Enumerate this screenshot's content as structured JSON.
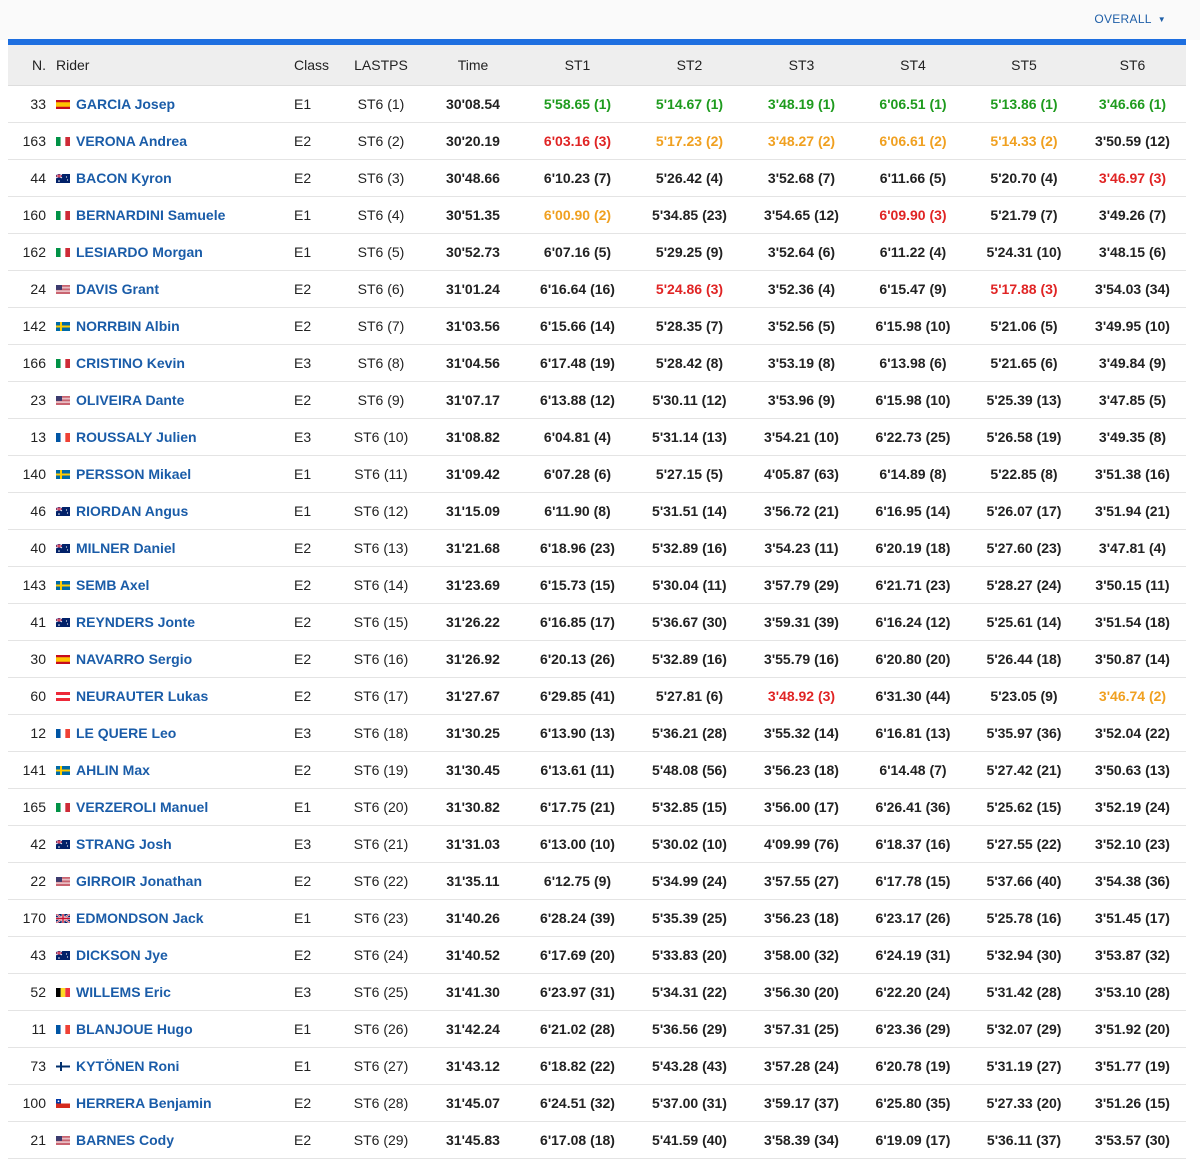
{
  "header": {
    "overall_label": "OVERALL"
  },
  "columns": [
    "N.",
    "Rider",
    "Class",
    "LASTPS",
    "Time",
    "ST1",
    "ST2",
    "ST3",
    "ST4",
    "ST5",
    "ST6"
  ],
  "rows": [
    {
      "n": "33",
      "flag": "es",
      "rider": "GARCIA Josep",
      "cls": "E1",
      "last": "ST6 (1)",
      "time": "30'08.54",
      "st": [
        "5'58.65 (1)",
        "5'14.67 (1)",
        "3'48.19 (1)",
        "6'06.51 (1)",
        "5'13.86 (1)",
        "3'46.66 (1)"
      ],
      "hl": [
        "green",
        "green",
        "green",
        "green",
        "green",
        "green"
      ]
    },
    {
      "n": "163",
      "flag": "it",
      "rider": "VERONA Andrea",
      "cls": "E2",
      "last": "ST6 (2)",
      "time": "30'20.19",
      "st": [
        "6'03.16 (3)",
        "5'17.23 (2)",
        "3'48.27 (2)",
        "6'06.61 (2)",
        "5'14.33 (2)",
        "3'50.59 (12)"
      ],
      "hl": [
        "red",
        "orange",
        "orange",
        "orange",
        "orange",
        ""
      ]
    },
    {
      "n": "44",
      "flag": "au",
      "rider": "BACON Kyron",
      "cls": "E2",
      "last": "ST6 (3)",
      "time": "30'48.66",
      "st": [
        "6'10.23 (7)",
        "5'26.42 (4)",
        "3'52.68 (7)",
        "6'11.66 (5)",
        "5'20.70 (4)",
        "3'46.97 (3)"
      ],
      "hl": [
        "",
        "",
        "",
        "",
        "",
        "red"
      ]
    },
    {
      "n": "160",
      "flag": "it",
      "rider": "BERNARDINI Samuele",
      "cls": "E1",
      "last": "ST6 (4)",
      "time": "30'51.35",
      "st": [
        "6'00.90 (2)",
        "5'34.85 (23)",
        "3'54.65 (12)",
        "6'09.90 (3)",
        "5'21.79 (7)",
        "3'49.26 (7)"
      ],
      "hl": [
        "orange",
        "",
        "",
        "red",
        "",
        ""
      ]
    },
    {
      "n": "162",
      "flag": "it",
      "rider": "LESIARDO Morgan",
      "cls": "E1",
      "last": "ST6 (5)",
      "time": "30'52.73",
      "st": [
        "6'07.16 (5)",
        "5'29.25 (9)",
        "3'52.64 (6)",
        "6'11.22 (4)",
        "5'24.31 (10)",
        "3'48.15 (6)"
      ],
      "hl": [
        "",
        "",
        "",
        "",
        "",
        ""
      ]
    },
    {
      "n": "24",
      "flag": "us",
      "rider": "DAVIS Grant",
      "cls": "E2",
      "last": "ST6 (6)",
      "time": "31'01.24",
      "st": [
        "6'16.64 (16)",
        "5'24.86 (3)",
        "3'52.36 (4)",
        "6'15.47 (9)",
        "5'17.88 (3)",
        "3'54.03 (34)"
      ],
      "hl": [
        "",
        "red",
        "",
        "",
        "red",
        ""
      ]
    },
    {
      "n": "142",
      "flag": "se",
      "rider": "NORRBIN Albin",
      "cls": "E2",
      "last": "ST6 (7)",
      "time": "31'03.56",
      "st": [
        "6'15.66 (14)",
        "5'28.35 (7)",
        "3'52.56 (5)",
        "6'15.98 (10)",
        "5'21.06 (5)",
        "3'49.95 (10)"
      ],
      "hl": [
        "",
        "",
        "",
        "",
        "",
        ""
      ]
    },
    {
      "n": "166",
      "flag": "it",
      "rider": "CRISTINO Kevin",
      "cls": "E3",
      "last": "ST6 (8)",
      "time": "31'04.56",
      "st": [
        "6'17.48 (19)",
        "5'28.42 (8)",
        "3'53.19 (8)",
        "6'13.98 (6)",
        "5'21.65 (6)",
        "3'49.84 (9)"
      ],
      "hl": [
        "",
        "",
        "",
        "",
        "",
        ""
      ]
    },
    {
      "n": "23",
      "flag": "us",
      "rider": "OLIVEIRA Dante",
      "cls": "E2",
      "last": "ST6 (9)",
      "time": "31'07.17",
      "st": [
        "6'13.88 (12)",
        "5'30.11 (12)",
        "3'53.96 (9)",
        "6'15.98 (10)",
        "5'25.39 (13)",
        "3'47.85 (5)"
      ],
      "hl": [
        "",
        "",
        "",
        "",
        "",
        ""
      ]
    },
    {
      "n": "13",
      "flag": "fr",
      "rider": "ROUSSALY Julien",
      "cls": "E3",
      "last": "ST6 (10)",
      "time": "31'08.82",
      "st": [
        "6'04.81 (4)",
        "5'31.14 (13)",
        "3'54.21 (10)",
        "6'22.73 (25)",
        "5'26.58 (19)",
        "3'49.35 (8)"
      ],
      "hl": [
        "",
        "",
        "",
        "",
        "",
        ""
      ]
    },
    {
      "n": "140",
      "flag": "se",
      "rider": "PERSSON Mikael",
      "cls": "E1",
      "last": "ST6 (11)",
      "time": "31'09.42",
      "st": [
        "6'07.28 (6)",
        "5'27.15 (5)",
        "4'05.87 (63)",
        "6'14.89 (8)",
        "5'22.85 (8)",
        "3'51.38 (16)"
      ],
      "hl": [
        "",
        "",
        "",
        "",
        "",
        ""
      ]
    },
    {
      "n": "46",
      "flag": "au",
      "rider": "RIORDAN Angus",
      "cls": "E1",
      "last": "ST6 (12)",
      "time": "31'15.09",
      "st": [
        "6'11.90 (8)",
        "5'31.51 (14)",
        "3'56.72 (21)",
        "6'16.95 (14)",
        "5'26.07 (17)",
        "3'51.94 (21)"
      ],
      "hl": [
        "",
        "",
        "",
        "",
        "",
        ""
      ]
    },
    {
      "n": "40",
      "flag": "au",
      "rider": "MILNER Daniel",
      "cls": "E2",
      "last": "ST6 (13)",
      "time": "31'21.68",
      "st": [
        "6'18.96 (23)",
        "5'32.89 (16)",
        "3'54.23 (11)",
        "6'20.19 (18)",
        "5'27.60 (23)",
        "3'47.81 (4)"
      ],
      "hl": [
        "",
        "",
        "",
        "",
        "",
        ""
      ]
    },
    {
      "n": "143",
      "flag": "se",
      "rider": "SEMB Axel",
      "cls": "E2",
      "last": "ST6 (14)",
      "time": "31'23.69",
      "st": [
        "6'15.73 (15)",
        "5'30.04 (11)",
        "3'57.79 (29)",
        "6'21.71 (23)",
        "5'28.27 (24)",
        "3'50.15 (11)"
      ],
      "hl": [
        "",
        "",
        "",
        "",
        "",
        ""
      ]
    },
    {
      "n": "41",
      "flag": "au",
      "rider": "REYNDERS Jonte",
      "cls": "E2",
      "last": "ST6 (15)",
      "time": "31'26.22",
      "st": [
        "6'16.85 (17)",
        "5'36.67 (30)",
        "3'59.31 (39)",
        "6'16.24 (12)",
        "5'25.61 (14)",
        "3'51.54 (18)"
      ],
      "hl": [
        "",
        "",
        "",
        "",
        "",
        ""
      ]
    },
    {
      "n": "30",
      "flag": "es",
      "rider": "NAVARRO Sergio",
      "cls": "E2",
      "last": "ST6 (16)",
      "time": "31'26.92",
      "st": [
        "6'20.13 (26)",
        "5'32.89 (16)",
        "3'55.79 (16)",
        "6'20.80 (20)",
        "5'26.44 (18)",
        "3'50.87 (14)"
      ],
      "hl": [
        "",
        "",
        "",
        "",
        "",
        ""
      ]
    },
    {
      "n": "60",
      "flag": "at",
      "rider": "NEURAUTER Lukas",
      "cls": "E2",
      "last": "ST6 (17)",
      "time": "31'27.67",
      "st": [
        "6'29.85 (41)",
        "5'27.81 (6)",
        "3'48.92 (3)",
        "6'31.30 (44)",
        "5'23.05 (9)",
        "3'46.74 (2)"
      ],
      "hl": [
        "",
        "",
        "red",
        "",
        "",
        "orange"
      ]
    },
    {
      "n": "12",
      "flag": "fr",
      "rider": "LE QUERE Leo",
      "cls": "E3",
      "last": "ST6 (18)",
      "time": "31'30.25",
      "st": [
        "6'13.90 (13)",
        "5'36.21 (28)",
        "3'55.32 (14)",
        "6'16.81 (13)",
        "5'35.97 (36)",
        "3'52.04 (22)"
      ],
      "hl": [
        "",
        "",
        "",
        "",
        "",
        ""
      ]
    },
    {
      "n": "141",
      "flag": "se",
      "rider": "AHLIN Max",
      "cls": "E2",
      "last": "ST6 (19)",
      "time": "31'30.45",
      "st": [
        "6'13.61 (11)",
        "5'48.08 (56)",
        "3'56.23 (18)",
        "6'14.48 (7)",
        "5'27.42 (21)",
        "3'50.63 (13)"
      ],
      "hl": [
        "",
        "",
        "",
        "",
        "",
        ""
      ]
    },
    {
      "n": "165",
      "flag": "it",
      "rider": "VERZEROLI Manuel",
      "cls": "E1",
      "last": "ST6 (20)",
      "time": "31'30.82",
      "st": [
        "6'17.75 (21)",
        "5'32.85 (15)",
        "3'56.00 (17)",
        "6'26.41 (36)",
        "5'25.62 (15)",
        "3'52.19 (24)"
      ],
      "hl": [
        "",
        "",
        "",
        "",
        "",
        ""
      ]
    },
    {
      "n": "42",
      "flag": "au",
      "rider": "STRANG Josh",
      "cls": "E3",
      "last": "ST6 (21)",
      "time": "31'31.03",
      "st": [
        "6'13.00 (10)",
        "5'30.02 (10)",
        "4'09.99 (76)",
        "6'18.37 (16)",
        "5'27.55 (22)",
        "3'52.10 (23)"
      ],
      "hl": [
        "",
        "",
        "",
        "",
        "",
        ""
      ]
    },
    {
      "n": "22",
      "flag": "us",
      "rider": "GIRROIR Jonathan",
      "cls": "E2",
      "last": "ST6 (22)",
      "time": "31'35.11",
      "st": [
        "6'12.75 (9)",
        "5'34.99 (24)",
        "3'57.55 (27)",
        "6'17.78 (15)",
        "5'37.66 (40)",
        "3'54.38 (36)"
      ],
      "hl": [
        "",
        "",
        "",
        "",
        "",
        ""
      ]
    },
    {
      "n": "170",
      "flag": "gb",
      "rider": "EDMONDSON Jack",
      "cls": "E1",
      "last": "ST6 (23)",
      "time": "31'40.26",
      "st": [
        "6'28.24 (39)",
        "5'35.39 (25)",
        "3'56.23 (18)",
        "6'23.17 (26)",
        "5'25.78 (16)",
        "3'51.45 (17)"
      ],
      "hl": [
        "",
        "",
        "",
        "",
        "",
        ""
      ]
    },
    {
      "n": "43",
      "flag": "au",
      "rider": "DICKSON Jye",
      "cls": "E2",
      "last": "ST6 (24)",
      "time": "31'40.52",
      "st": [
        "6'17.69 (20)",
        "5'33.83 (20)",
        "3'58.00 (32)",
        "6'24.19 (31)",
        "5'32.94 (30)",
        "3'53.87 (32)"
      ],
      "hl": [
        "",
        "",
        "",
        "",
        "",
        ""
      ]
    },
    {
      "n": "52",
      "flag": "be",
      "rider": "WILLEMS Eric",
      "cls": "E3",
      "last": "ST6 (25)",
      "time": "31'41.30",
      "st": [
        "6'23.97 (31)",
        "5'34.31 (22)",
        "3'56.30 (20)",
        "6'22.20 (24)",
        "5'31.42 (28)",
        "3'53.10 (28)"
      ],
      "hl": [
        "",
        "",
        "",
        "",
        "",
        ""
      ]
    },
    {
      "n": "11",
      "flag": "fr",
      "rider": "BLANJOUE Hugo",
      "cls": "E1",
      "last": "ST6 (26)",
      "time": "31'42.24",
      "st": [
        "6'21.02 (28)",
        "5'36.56 (29)",
        "3'57.31 (25)",
        "6'23.36 (29)",
        "5'32.07 (29)",
        "3'51.92 (20)"
      ],
      "hl": [
        "",
        "",
        "",
        "",
        "",
        ""
      ]
    },
    {
      "n": "73",
      "flag": "fi",
      "rider": "KYTÖNEN Roni",
      "cls": "E1",
      "last": "ST6 (27)",
      "time": "31'43.12",
      "st": [
        "6'18.82 (22)",
        "5'43.28 (43)",
        "3'57.28 (24)",
        "6'20.78 (19)",
        "5'31.19 (27)",
        "3'51.77 (19)"
      ],
      "hl": [
        "",
        "",
        "",
        "",
        "",
        ""
      ]
    },
    {
      "n": "100",
      "flag": "cl",
      "rider": "HERRERA Benjamin",
      "cls": "E2",
      "last": "ST6 (28)",
      "time": "31'45.07",
      "st": [
        "6'24.51 (32)",
        "5'37.00 (31)",
        "3'59.17 (37)",
        "6'25.80 (35)",
        "5'27.33 (20)",
        "3'51.26 (15)"
      ],
      "hl": [
        "",
        "",
        "",
        "",
        "",
        ""
      ]
    },
    {
      "n": "21",
      "flag": "us",
      "rider": "BARNES Cody",
      "cls": "E2",
      "last": "ST6 (29)",
      "time": "31'45.83",
      "st": [
        "6'17.08 (18)",
        "5'41.59 (40)",
        "3'58.39 (34)",
        "6'19.09 (17)",
        "5'36.11 (37)",
        "3'53.57 (30)"
      ],
      "hl": [
        "",
        "",
        "",
        "",
        "",
        ""
      ]
    }
  ]
}
